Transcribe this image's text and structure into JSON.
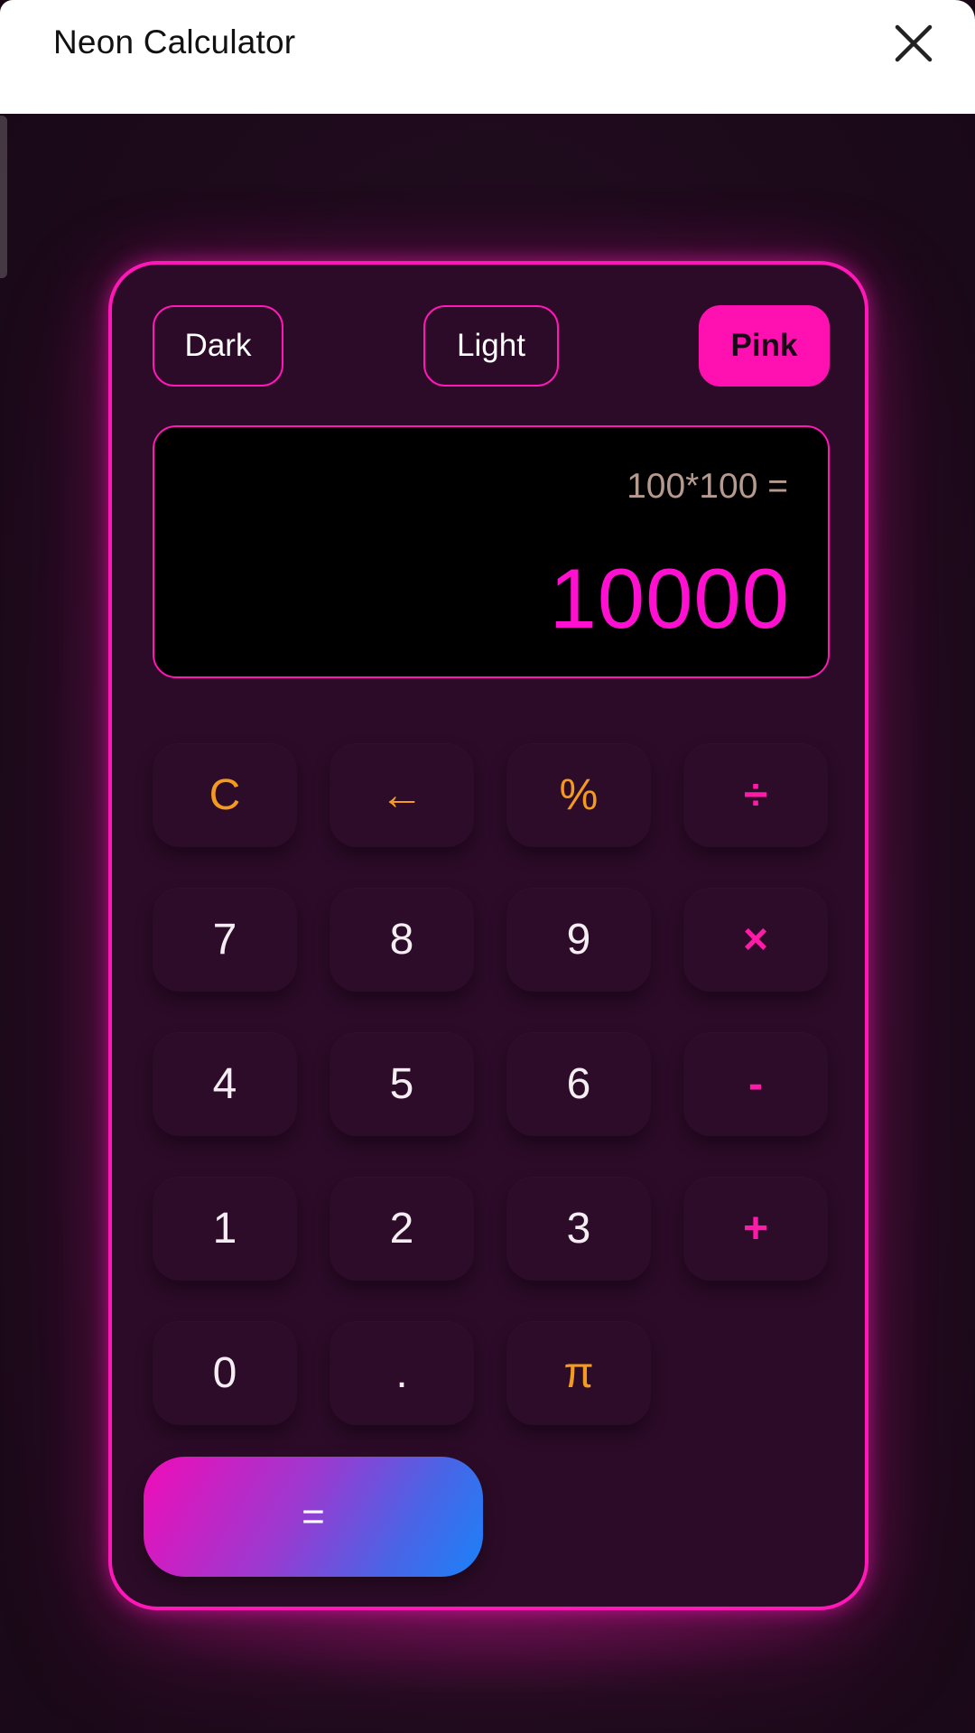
{
  "app": {
    "title": "Neon Calculator",
    "close_icon": "close-icon"
  },
  "themes": {
    "dark": "Dark",
    "light": "Light",
    "pink": "Pink",
    "selected": "Pink"
  },
  "display": {
    "expression": "100*100 =",
    "result": "10000"
  },
  "keys": {
    "clear": "C",
    "backspace": "←",
    "percent": "%",
    "divide": "÷",
    "seven": "7",
    "eight": "8",
    "nine": "9",
    "multiply": "×",
    "four": "4",
    "five": "5",
    "six": "6",
    "subtract": "-",
    "one": "1",
    "two": "2",
    "three": "3",
    "add": "+",
    "zero": "0",
    "decimal": ".",
    "pi": "π",
    "equals": "="
  },
  "colors": {
    "accent": "#ff17b8",
    "result": "#ff10d0",
    "function_key": "#f39a1f",
    "operator_key": "#ff1aa8",
    "panel": "#2c0b28",
    "background": "#1e0b1c"
  }
}
